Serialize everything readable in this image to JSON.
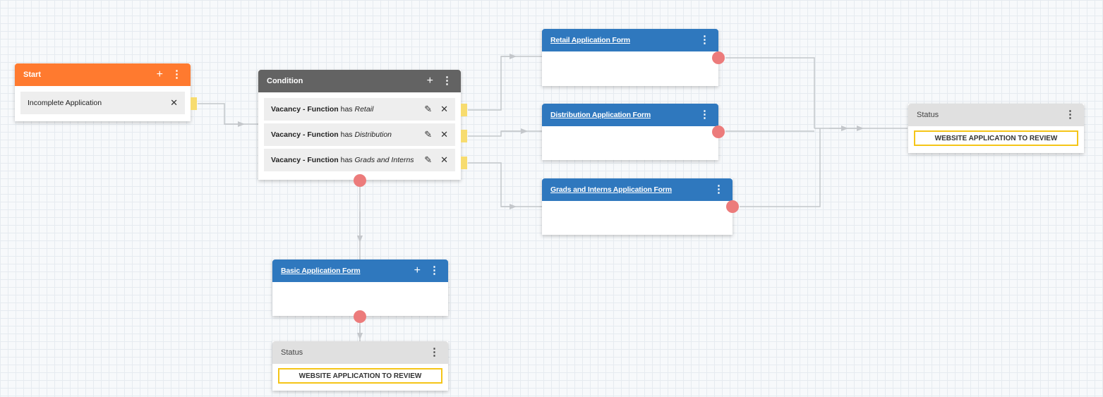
{
  "start": {
    "title": "Start",
    "item_label": "Incomplete Application"
  },
  "condition": {
    "title": "Condition",
    "rows": [
      {
        "field": "Vacancy - Function",
        "op": "has",
        "value": "Retail"
      },
      {
        "field": "Vacancy - Function",
        "op": "has",
        "value": "Distribution"
      },
      {
        "field": "Vacancy - Function",
        "op": "has",
        "value": "Grads and Interns"
      }
    ]
  },
  "forms": {
    "retail": "Retail Application Form",
    "distribution": "Distribution Application Form",
    "grads": "Grads and Interns Application Form",
    "basic": "Basic Application Form"
  },
  "status_right": {
    "title": "Status",
    "value": "WEBSITE APPLICATION TO REVIEW"
  },
  "status_bottom": {
    "title": "Status",
    "value": "WEBSITE APPLICATION TO REVIEW"
  },
  "icons": {
    "plus": "+",
    "more": "⋮",
    "close": "✕",
    "edit": "✎"
  },
  "colors": {
    "start": "#ff7a2f",
    "condition": "#636363",
    "form": "#2f78be",
    "status": "#e0e0e0",
    "badge_border": "#f5c518",
    "out_connector": "#ec7b7b",
    "in_connector": "#f7dc6f",
    "wire": "#c4c7cb"
  }
}
